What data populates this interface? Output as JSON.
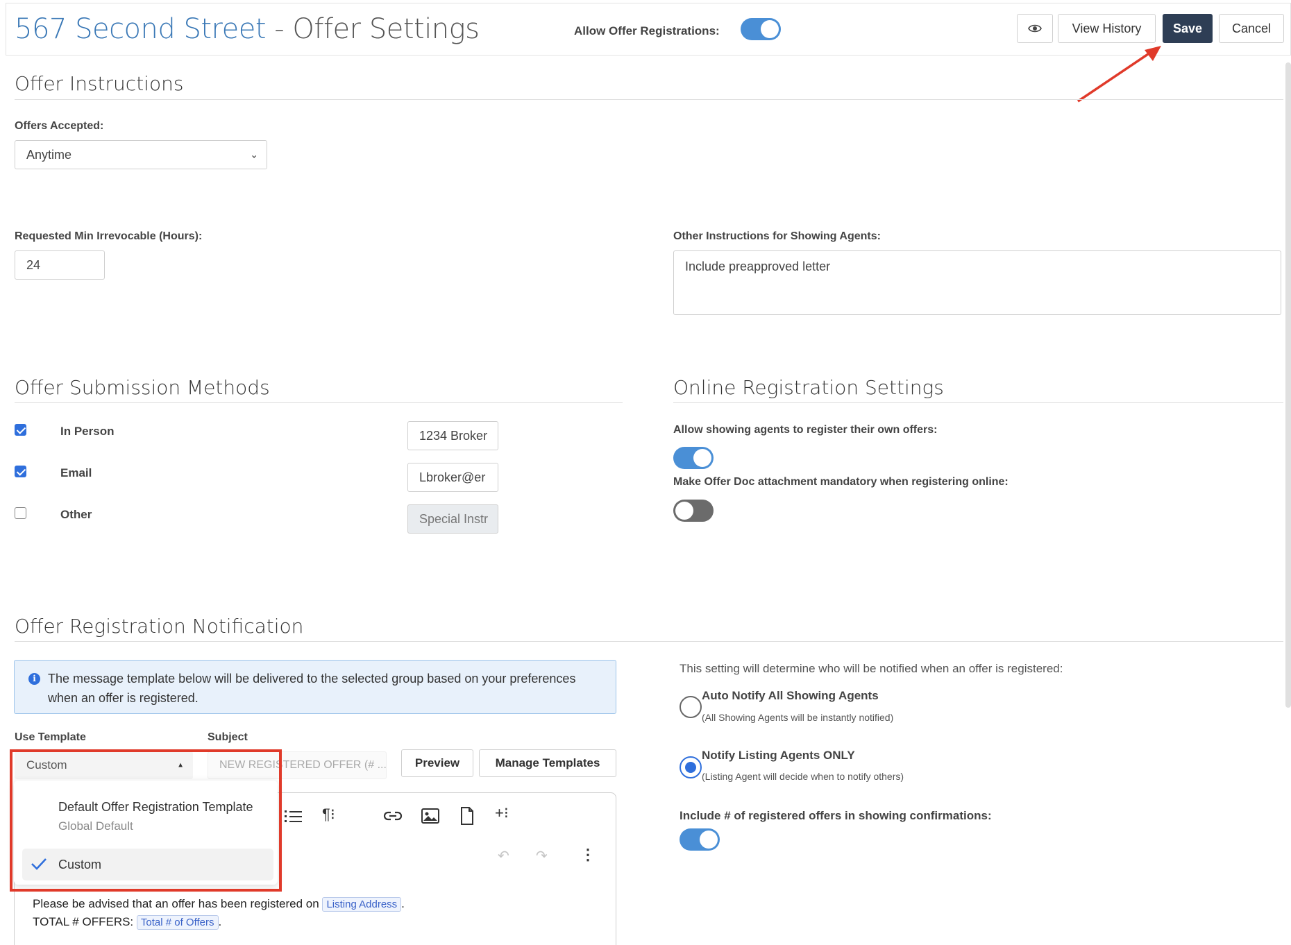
{
  "header": {
    "address": "567 Second Street",
    "separator": " - ",
    "title_suffix": "Offer Settings",
    "allow_registrations_label": "Allow Offer Registrations:",
    "allow_registrations_on": true,
    "view_history_label": "View History",
    "save_label": "Save",
    "cancel_label": "Cancel"
  },
  "offer_instructions": {
    "title": "Offer Instructions",
    "offers_accepted_label": "Offers Accepted:",
    "offers_accepted_value": "Anytime",
    "min_irrevocable_label": "Requested Min Irrevocable (Hours):",
    "min_irrevocable_value": "24",
    "other_instructions_label": "Other Instructions for Showing Agents:",
    "other_instructions_value": "Include preapproved letter"
  },
  "submission_methods": {
    "title": "Offer Submission Methods",
    "items": [
      {
        "label": "In Person",
        "checked": true,
        "value": "1234 Broker"
      },
      {
        "label": "Email",
        "checked": true,
        "value": "Lbroker@er"
      },
      {
        "label": "Other",
        "checked": false,
        "value": "Special Instr"
      }
    ]
  },
  "online_registration": {
    "title": "Online Registration Settings",
    "allow_agents_label": "Allow showing agents to register their own offers:",
    "allow_agents_on": true,
    "mandatory_doc_label": "Make Offer Doc attachment mandatory when registering online:",
    "mandatory_doc_on": false
  },
  "notification": {
    "title": "Offer Registration Notification",
    "info_text": "The message template below will be delivered to the selected group based on your preferences when an offer is registered.",
    "use_template_label": "Use Template",
    "use_template_value": "Custom",
    "subject_label": "Subject",
    "subject_placeholder": "NEW REGISTERED OFFER (# ...",
    "preview_label": "Preview",
    "manage_templates_label": "Manage Templates",
    "dropdown": {
      "items": [
        {
          "label": "Default Offer Registration Template",
          "sub": "Global Default",
          "selected": false
        },
        {
          "label": "Custom",
          "sub": "",
          "selected": true
        }
      ]
    },
    "editor": {
      "line1_text": "Please be advised that an offer has been registered on",
      "line1_chip": "Listing Address",
      "line1_end": ".",
      "line2_text": "TOTAL # OFFERS:",
      "line2_chip": "Total # of Offers",
      "line2_end": "."
    },
    "setting_intro": "This setting will determine who will be notified when an offer is registered:",
    "radios": [
      {
        "label": "Auto Notify All Showing Agents",
        "sub": "(All Showing Agents will be instantly notified)",
        "checked": false
      },
      {
        "label": "Notify Listing Agents ONLY",
        "sub": "(Listing Agent will decide when to notify others)",
        "checked": true
      }
    ],
    "include_count_label": "Include # of registered offers in showing confirmations:",
    "include_count_on": true
  },
  "colors": {
    "accent": "#4a8fd6",
    "primary_button": "#2e3e55",
    "annotation_red": "#e03a2a",
    "address_blue": "#3a78b6"
  }
}
